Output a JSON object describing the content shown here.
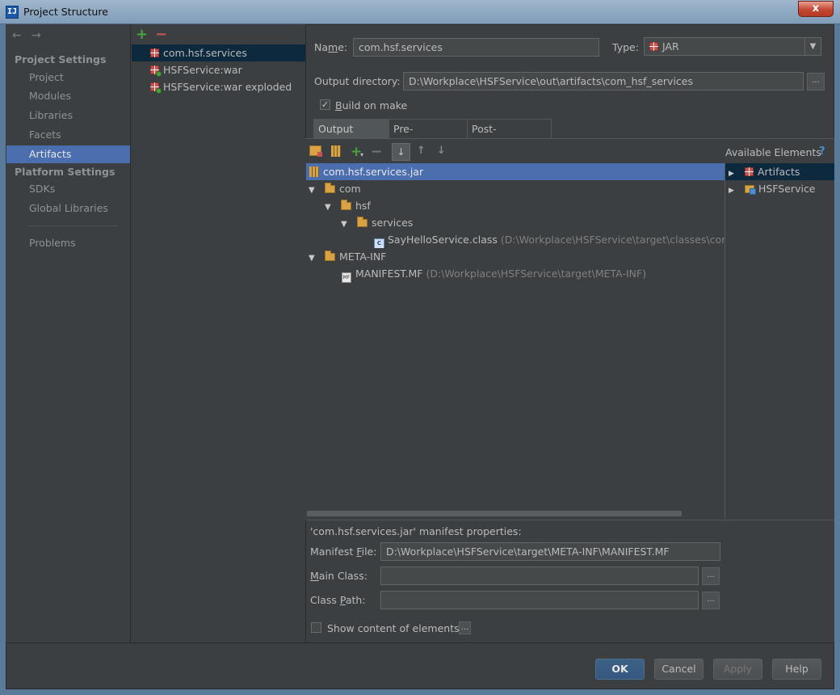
{
  "window": {
    "title": "Project Structure",
    "logo": "IJ",
    "close_label": "x"
  },
  "sidebar": {
    "back_icon": "←",
    "forward_icon": "→",
    "project_settings_header": "Project Settings",
    "project_settings": [
      "Project",
      "Modules",
      "Libraries",
      "Facets",
      "Artifacts"
    ],
    "platform_settings_header": "Platform Settings",
    "platform_settings": [
      "SDKs",
      "Global Libraries"
    ],
    "problems": "Problems",
    "active_item": "Artifacts"
  },
  "artifacts": {
    "add_icon": "+",
    "remove_icon": "−",
    "items": [
      "com.hsf.services",
      "HSFService:war",
      "HSFService:war exploded"
    ]
  },
  "form": {
    "name_label_pre": "Na",
    "name_label_ul": "m",
    "name_label_post": "e:",
    "name_value": "com.hsf.services",
    "type_label": "Type:",
    "type_value": "JAR",
    "output_dir_label": "Output directory:",
    "output_dir_value": "D:\\Workplace\\HSFService\\out\\artifacts\\com_hsf_services",
    "ellipsis": "...",
    "build_on_make_pre": "",
    "build_on_make_ul": "B",
    "build_on_make_post": "uild on make",
    "build_on_make_checked": "✓"
  },
  "tabs": [
    "Output Layout",
    "Pre-processing",
    "Post-processing"
  ],
  "layout_toolbar": {
    "add_icon": "+",
    "remove_icon": "−",
    "sort_icon": "↓",
    "up_icon": "↑",
    "down_icon": "↓",
    "dropdown_caret": "▾"
  },
  "tree": {
    "root": "com.hsf.services.jar",
    "com": "com",
    "hsf": "hsf",
    "services": "services",
    "class_file": "SayHelloService.class",
    "class_path": "(D:\\Workplace\\HSFService\\target\\classes\\com\\hsf",
    "meta_inf": "META-INF",
    "manifest_file": "MANIFEST.MF",
    "manifest_path": "(D:\\Workplace\\HSFService\\target\\META-INF)",
    "expanded_icon": "▼",
    "class_icon_text": "C",
    "mf_icon_text": "MF"
  },
  "available": {
    "title": "Available Elements",
    "help_icon": "?",
    "collapsed_icon": "▶",
    "items": [
      "Artifacts",
      "HSFService"
    ]
  },
  "manifest": {
    "heading": "'com.hsf.services.jar' manifest properties:",
    "manifest_file_label_pre": "Manifest ",
    "manifest_file_label_ul": "F",
    "manifest_file_label_post": "ile:",
    "manifest_file_value": "D:\\Workplace\\HSFService\\target\\META-INF\\MANIFEST.MF",
    "main_class_label_pre": "",
    "main_class_label_ul": "M",
    "main_class_label_post": "ain Class:",
    "main_class_value": "",
    "class_path_label_pre": "Class ",
    "class_path_label_ul": "P",
    "class_path_label_post": "ath:",
    "class_path_value": "",
    "show_content_label": "Show content of elements"
  },
  "footer": {
    "ok": "OK",
    "cancel": "Cancel",
    "apply": "Apply",
    "help": "Help"
  }
}
